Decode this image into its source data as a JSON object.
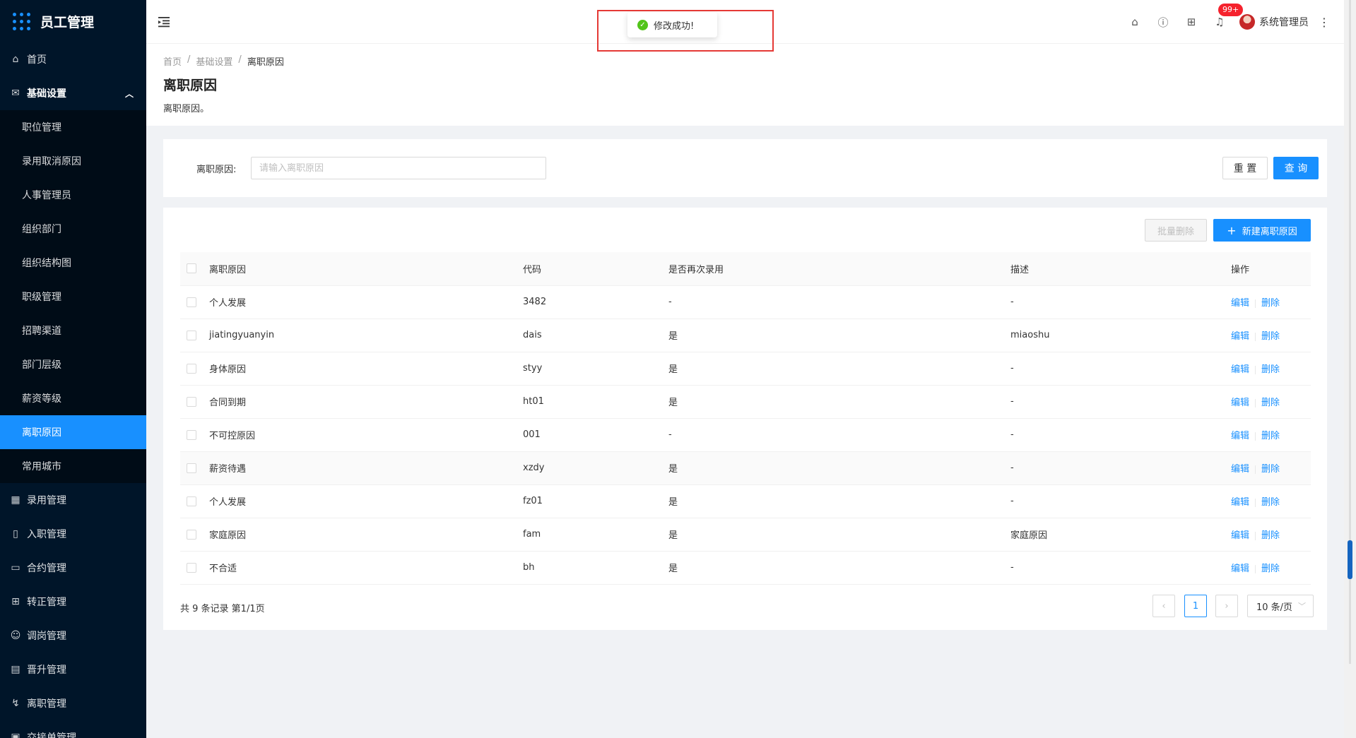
{
  "app": {
    "title": "员工管理"
  },
  "sidebar": {
    "items": [
      {
        "label": "首页",
        "icon": "home-icon"
      },
      {
        "label": "基础设置",
        "icon": "mail-icon",
        "open": true,
        "children": [
          "职位管理",
          "录用取消原因",
          "人事管理员",
          "组织部门",
          "组织结构图",
          "职级管理",
          "招聘渠道",
          "部门层级",
          "薪资等级",
          "离职原因",
          "常用城市"
        ],
        "active_child": "离职原因"
      },
      {
        "label": "录用管理",
        "icon": "table-icon"
      },
      {
        "label": "入职管理",
        "icon": "book-icon"
      },
      {
        "label": "合约管理",
        "icon": "calendar-icon"
      },
      {
        "label": "转正管理",
        "icon": "appstore-icon"
      },
      {
        "label": "调岗管理",
        "icon": "user-icon"
      },
      {
        "label": "晋升管理",
        "icon": "file-icon"
      },
      {
        "label": "离职管理",
        "icon": "logout-icon"
      },
      {
        "label": "交接单管理",
        "icon": "form-icon"
      }
    ]
  },
  "header": {
    "badge": "99+",
    "username": "系统管理员"
  },
  "toast": {
    "message": "修改成功!"
  },
  "page": {
    "breadcrumb": [
      "首页",
      "基础设置",
      "离职原因"
    ],
    "title": "离职原因",
    "description": "离职原因。"
  },
  "search": {
    "label": "离职原因:",
    "placeholder": "请输入离职原因",
    "value": "",
    "reset": "重 置",
    "query": "查 询"
  },
  "toolbar": {
    "batch_delete": "批量删除",
    "new_button": "新建离职原因"
  },
  "table": {
    "columns": [
      "离职原因",
      "代码",
      "是否再次录用",
      "描述",
      "操作"
    ],
    "rows": [
      {
        "reason": "个人发展",
        "code": "3482",
        "rehire": "-",
        "desc": "-"
      },
      {
        "reason": "jiatingyuanyin",
        "code": "dais",
        "rehire": "是",
        "desc": "miaoshu"
      },
      {
        "reason": "身体原因",
        "code": "styy",
        "rehire": "是",
        "desc": "-"
      },
      {
        "reason": "合同到期",
        "code": "ht01",
        "rehire": "是",
        "desc": "-"
      },
      {
        "reason": "不可控原因",
        "code": "001",
        "rehire": "-",
        "desc": "-"
      },
      {
        "reason": "薪资待遇",
        "code": "xzdy",
        "rehire": "是",
        "desc": "-"
      },
      {
        "reason": "个人发展",
        "code": "fz01",
        "rehire": "是",
        "desc": "-"
      },
      {
        "reason": "家庭原因",
        "code": "fam",
        "rehire": "是",
        "desc": "家庭原因"
      },
      {
        "reason": "不合适",
        "code": "bh",
        "rehire": "是",
        "desc": "-"
      }
    ],
    "edit_label": "编辑",
    "delete_label": "删除"
  },
  "pagination": {
    "total_text": "共 9 条记录 第1/1页",
    "current_page": "1",
    "page_size": "10 条/页"
  },
  "colors": {
    "primary": "#1890ff",
    "sidebar": "#001529",
    "success": "#52c41a",
    "highlight_box": "#e53935"
  }
}
